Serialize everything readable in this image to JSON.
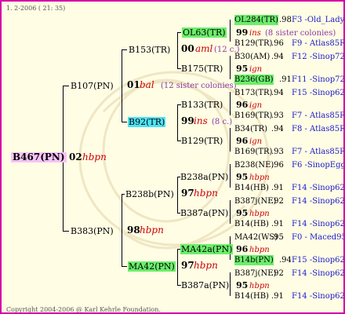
{
  "header": {
    "date": "1. 2-2006 ( 21: 35)"
  },
  "footer": {
    "copyright": "Copyright 2004-2006 @ Karl Kehrle Foundation."
  },
  "root": {
    "id": "B467(PN)",
    "year": "02",
    "breed": "hbpn"
  },
  "gen1": {
    "sire": {
      "id": "B107(PN)",
      "year": "01",
      "breed": "bal",
      "note": "(12 sister colonies)"
    },
    "dam": {
      "id": "B383(PN)",
      "year": "98",
      "breed": "hbpn"
    }
  },
  "gen2": {
    "a": {
      "id": "B153(TR)",
      "year": "00",
      "breed": "aml",
      "note": "(12 c.)"
    },
    "b": {
      "id": "B92(TR)",
      "year": "99",
      "breed": "ins",
      "note": "(8 c.)"
    },
    "c": {
      "id": "B238b(PN)",
      "year": "97",
      "breed": "hbpn"
    },
    "d": {
      "id": "MA42(PN)",
      "year": "97",
      "breed": "hbpn"
    }
  },
  "gen3": {
    "a1": {
      "id": "OL63(TR)",
      "year": "99",
      "breed": "ins",
      "note": "(8 sister colonies)"
    },
    "a2": {
      "id": "B175(TR)",
      "year": "95",
      "breed": "ign"
    },
    "b1": {
      "id": "B133(TR)",
      "year": "96",
      "breed": "ign"
    },
    "b2": {
      "id": "B129(TR)",
      "year": "96",
      "breed": "ign"
    },
    "c1": {
      "id": "B238a(PN)",
      "year": "95",
      "breed": "hbpn"
    },
    "c2": {
      "id": "B387a(PN)",
      "year": "95",
      "breed": "hbpn"
    },
    "d1": {
      "id": "MA42a(PN)",
      "year": "96",
      "breed": "hbpn"
    },
    "d2": {
      "id": "B387a(PN)",
      "year": "95",
      "breed": "hbpn"
    }
  },
  "gen4": [
    {
      "id": "OL284(TR)",
      "score": ".98",
      "ref": "F3 -Old_Lady"
    },
    {
      "id": "B129(TR)",
      "score": ".96",
      "ref": "F9 - Atlas85R"
    },
    {
      "id": "B30(AM)",
      "score": ".94",
      "ref": "F12 -Sinop72R"
    },
    {
      "id": "B236(GB)",
      "score": ".91",
      "ref": "F11 -Sinop72R"
    },
    {
      "id": "B173(TR)",
      "score": ".94",
      "ref": "F15 -Sinop62R"
    },
    {
      "id": "B169(TR)",
      "score": ".93",
      "ref": "F7 - Atlas85R"
    },
    {
      "id": "B34(TR)",
      "score": ".94",
      "ref": "F8 - Atlas85R"
    },
    {
      "id": "B169(TR)",
      "score": ".93",
      "ref": "F7 - Atlas85R"
    },
    {
      "id": "B238(NE)",
      "score": ".96",
      "ref": "F6 -SinopEgg86R"
    },
    {
      "id": "B14(HB)",
      "score": ".91",
      "ref": "F14 -Sinop62R"
    },
    {
      "id": "B387j(NE)",
      "score": ".92",
      "ref": "F14 -Sinop62R"
    },
    {
      "id": "B14(HB)",
      "score": ".91",
      "ref": "F14 -Sinop62R"
    },
    {
      "id": "MA42(WS)",
      "score": ".95",
      "ref": "F0 - Maced95R"
    },
    {
      "id": "B14b(PN)",
      "score": ".94",
      "ref": "F15 -Sinop62R"
    },
    {
      "id": "B387j(NE)",
      "score": ".92",
      "ref": "F14 -Sinop62R"
    },
    {
      "id": "B14(HB)",
      "score": ".91",
      "ref": "F14 -Sinop62R"
    }
  ],
  "colors": {
    "frame": "#d600a8",
    "background": "#fffde4",
    "root_highlight": "#f8c3f8",
    "green_highlight": "#6bee6b",
    "cyan_highlight": "#4fe3f5",
    "ref_text": "#1a1acc",
    "breed_text": "#cc0000"
  }
}
